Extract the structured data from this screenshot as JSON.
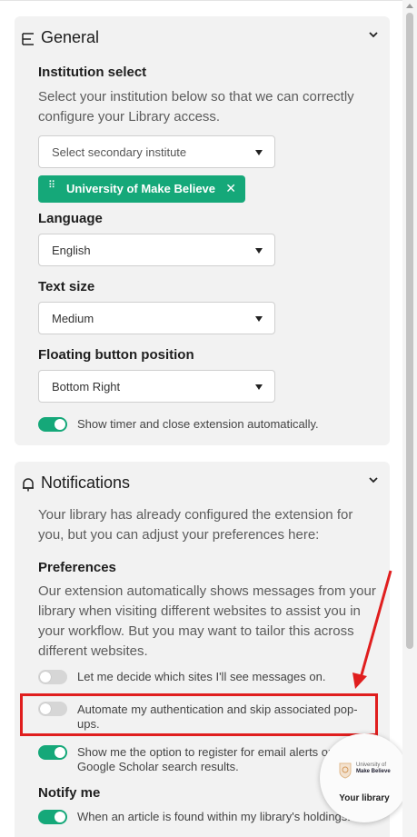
{
  "general": {
    "title": "General",
    "institution": {
      "label": "Institution select",
      "description": "Select your institution below so that we can correctly configure your Library access.",
      "select_placeholder": "Select secondary institute",
      "chip_label": "University of Make Believe"
    },
    "language": {
      "label": "Language",
      "value": "English"
    },
    "text_size": {
      "label": "Text size",
      "value": "Medium"
    },
    "floating_button": {
      "label": "Floating button position",
      "value": "Bottom Right"
    },
    "timer_toggle": {
      "label": "Show timer and close extension automatically.",
      "on": true
    }
  },
  "notifications": {
    "title": "Notifications",
    "intro": "Your library has already configured the extension for you, but you can adjust your preferences here:",
    "preferences_label": "Preferences",
    "preferences_text": "Our extension automatically shows messages from your library when visiting different websites to assist you in your workflow. But you may want to tailor this across different websites.",
    "toggles": [
      {
        "label": "Let me decide which sites I'll see messages on.",
        "on": false
      },
      {
        "label": "Automate my authentication and skip associated pop-ups.",
        "on": false
      },
      {
        "label": "Show me the option to register for email alerts on Google Scholar search results.",
        "on": true
      }
    ],
    "notify_me_label": "Notify me",
    "notify_toggle": {
      "label": "When an article is found within my library's holdings.",
      "on": true
    }
  },
  "floating_button": {
    "logo_line1": "University of",
    "logo_line2": "Make Believe",
    "label": "Your library"
  },
  "colors": {
    "accent": "#15a879",
    "annotation": "#e01e1e",
    "card": "#f2f2f2"
  }
}
